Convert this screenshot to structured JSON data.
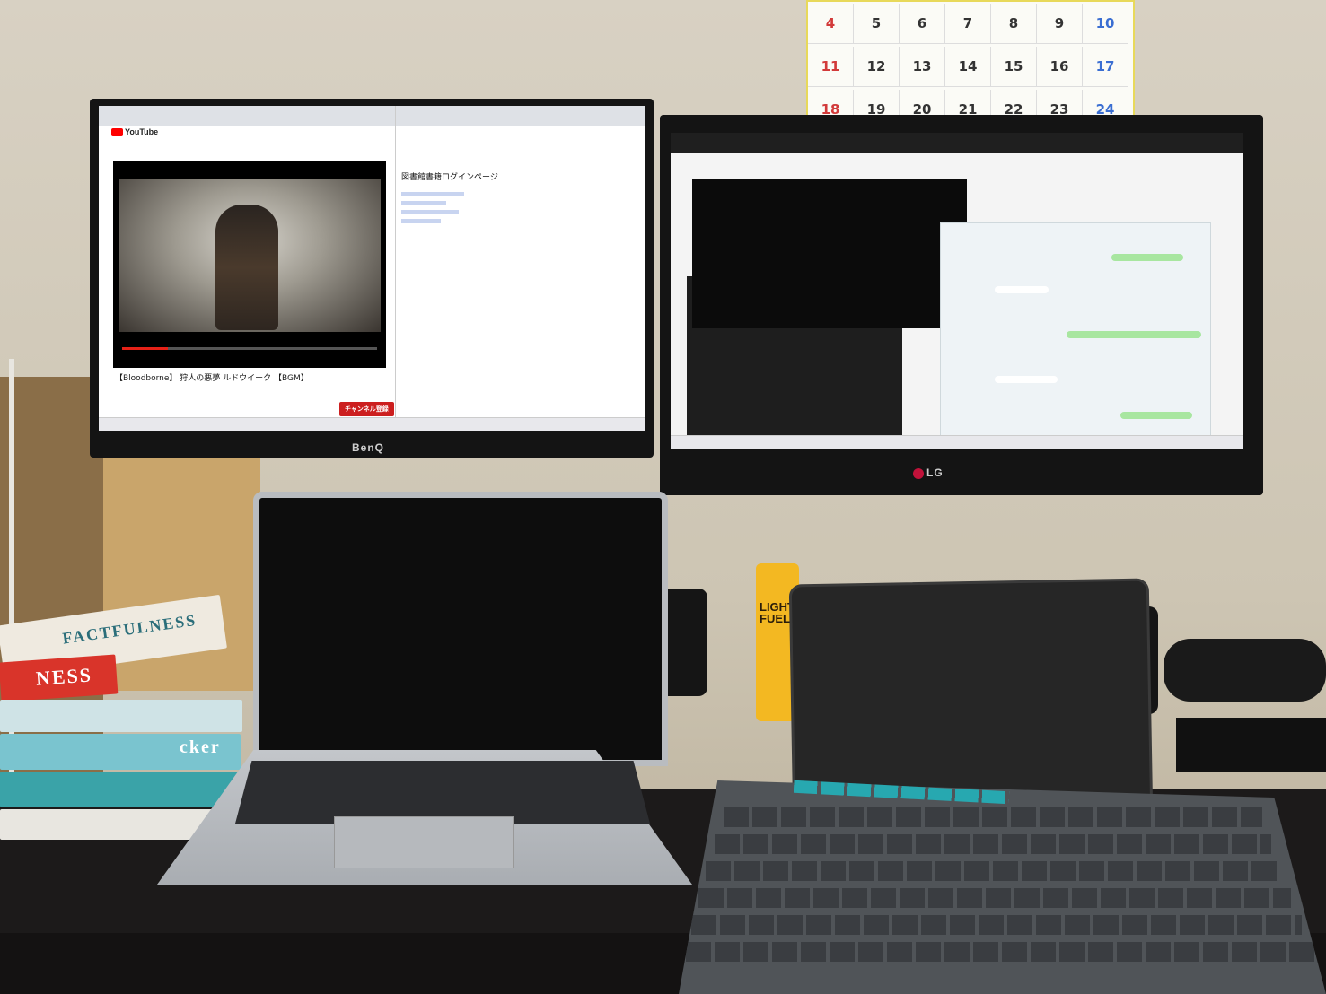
{
  "calendar": {
    "rows": [
      [
        "4",
        "5",
        "6",
        "7",
        "8",
        "9",
        "10"
      ],
      [
        "11",
        "12",
        "13",
        "14",
        "15",
        "16",
        "17"
      ],
      [
        "18",
        "19",
        "20",
        "21",
        "22",
        "23",
        "24"
      ]
    ]
  },
  "monitor_left": {
    "brand": "BenQ",
    "youtube": {
      "logo": "YouTube",
      "video_title": "【Bloodborne】 狩人の悪夢 ルドウイーク 【BGM】",
      "subscribe_label": "チャンネル登録"
    },
    "browser": {
      "heading": "図書館書籍ログインページ"
    }
  },
  "monitor_right": {
    "brand": "LG"
  },
  "bottle": {
    "label_line1": "LIGHTER",
    "label_line2": "FUEL"
  },
  "books": {
    "factfulness": "FACTFULNESS",
    "factfulness_spine": "NESS",
    "hacker": "cker"
  },
  "colors": {
    "youtube_red": "#e62117",
    "lg_red": "#c1123a",
    "keyboard_accent": "#27a8b0",
    "bottle_yellow": "#f3b822"
  }
}
